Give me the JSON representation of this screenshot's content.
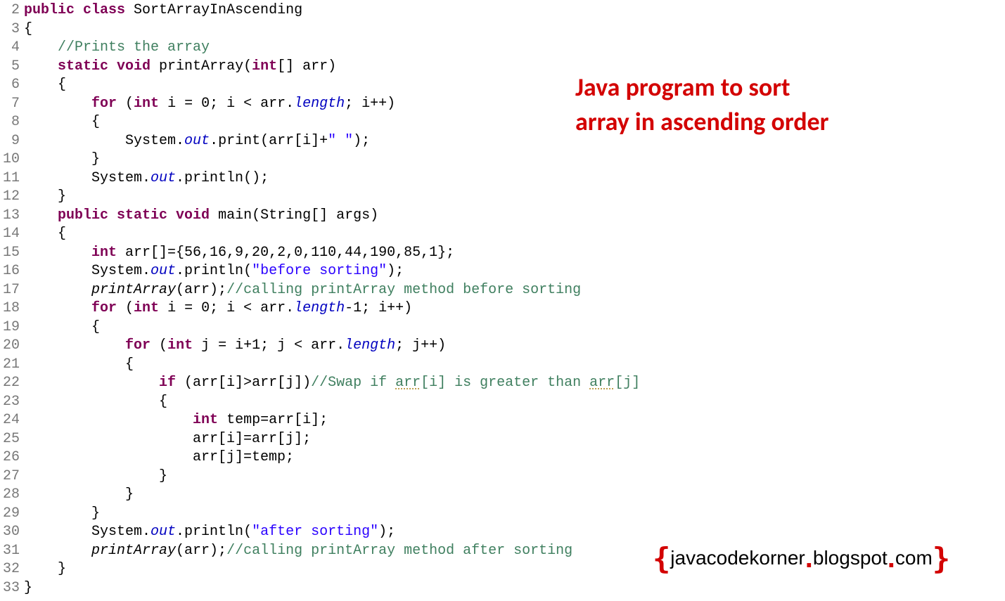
{
  "overlay": {
    "title_line1": "Java program to sort",
    "title_line2": "array in ascending order",
    "watermark_text": "javacodekorner",
    "watermark_domain": "blogspot",
    "watermark_tld": "com"
  },
  "gutter": {
    "start": 2,
    "end": 33
  },
  "code": {
    "lines": [
      {
        "n": 2,
        "segs": [
          {
            "t": "public class ",
            "c": "kw"
          },
          {
            "t": "SortArrayInAscending"
          }
        ]
      },
      {
        "n": 3,
        "segs": [
          {
            "t": "{"
          }
        ]
      },
      {
        "n": 4,
        "segs": [
          {
            "t": "    "
          },
          {
            "t": "//Prints the array",
            "c": "comment"
          }
        ]
      },
      {
        "n": 5,
        "segs": [
          {
            "t": "    "
          },
          {
            "t": "static void ",
            "c": "kw"
          },
          {
            "t": "printArray("
          },
          {
            "t": "int",
            "c": "kw"
          },
          {
            "t": "[] arr)"
          }
        ]
      },
      {
        "n": 6,
        "segs": [
          {
            "t": "    {"
          }
        ]
      },
      {
        "n": 7,
        "segs": [
          {
            "t": "        "
          },
          {
            "t": "for ",
            "c": "kw"
          },
          {
            "t": "("
          },
          {
            "t": "int ",
            "c": "kw"
          },
          {
            "t": "i = 0; i < arr."
          },
          {
            "t": "length",
            "c": "field"
          },
          {
            "t": "; i++)"
          }
        ]
      },
      {
        "n": 8,
        "segs": [
          {
            "t": "        {"
          }
        ]
      },
      {
        "n": 9,
        "segs": [
          {
            "t": "            System."
          },
          {
            "t": "out",
            "c": "field"
          },
          {
            "t": ".print(arr[i]+"
          },
          {
            "t": "\" \"",
            "c": "str"
          },
          {
            "t": ");"
          }
        ]
      },
      {
        "n": 10,
        "segs": [
          {
            "t": "        }"
          }
        ]
      },
      {
        "n": 11,
        "segs": [
          {
            "t": "        System."
          },
          {
            "t": "out",
            "c": "field"
          },
          {
            "t": ".println();"
          }
        ]
      },
      {
        "n": 12,
        "segs": [
          {
            "t": "    }"
          }
        ]
      },
      {
        "n": 13,
        "segs": [
          {
            "t": "    "
          },
          {
            "t": "public static void ",
            "c": "kw"
          },
          {
            "t": "main(String[] args)"
          }
        ]
      },
      {
        "n": 14,
        "segs": [
          {
            "t": "    {"
          }
        ]
      },
      {
        "n": 15,
        "segs": [
          {
            "t": "        "
          },
          {
            "t": "int ",
            "c": "kw"
          },
          {
            "t": "arr[]={56,16,9,20,2,0,110,44,190,85,1};"
          }
        ]
      },
      {
        "n": 16,
        "segs": [
          {
            "t": "        System."
          },
          {
            "t": "out",
            "c": "field"
          },
          {
            "t": ".println("
          },
          {
            "t": "\"before sorting\"",
            "c": "str"
          },
          {
            "t": ");"
          }
        ]
      },
      {
        "n": 17,
        "segs": [
          {
            "t": "        "
          },
          {
            "t": "printArray",
            "c": "call-italic"
          },
          {
            "t": "(arr);"
          },
          {
            "t": "//calling printArray method before sorting",
            "c": "comment"
          }
        ]
      },
      {
        "n": 18,
        "segs": [
          {
            "t": "        "
          },
          {
            "t": "for ",
            "c": "kw"
          },
          {
            "t": "("
          },
          {
            "t": "int ",
            "c": "kw"
          },
          {
            "t": "i = 0; i < arr."
          },
          {
            "t": "length",
            "c": "field"
          },
          {
            "t": "-1; i++)"
          }
        ]
      },
      {
        "n": 19,
        "segs": [
          {
            "t": "        {"
          }
        ]
      },
      {
        "n": 20,
        "segs": [
          {
            "t": "            "
          },
          {
            "t": "for ",
            "c": "kw"
          },
          {
            "t": "("
          },
          {
            "t": "int ",
            "c": "kw"
          },
          {
            "t": "j = i+1; j < arr."
          },
          {
            "t": "length",
            "c": "field"
          },
          {
            "t": "; j++)"
          }
        ]
      },
      {
        "n": 21,
        "segs": [
          {
            "t": "            {"
          }
        ]
      },
      {
        "n": 22,
        "segs": [
          {
            "t": "                "
          },
          {
            "t": "if ",
            "c": "kw"
          },
          {
            "t": "(arr[i]>arr[j])"
          },
          {
            "t": "//Swap if ",
            "c": "comment"
          },
          {
            "t": "arr",
            "c": "comment underline-dot"
          },
          {
            "t": "[i] is greater than ",
            "c": "comment"
          },
          {
            "t": "arr",
            "c": "comment underline-dot2"
          },
          {
            "t": "[j]",
            "c": "comment"
          }
        ]
      },
      {
        "n": 23,
        "segs": [
          {
            "t": "                {"
          }
        ]
      },
      {
        "n": 24,
        "segs": [
          {
            "t": "                    "
          },
          {
            "t": "int ",
            "c": "kw"
          },
          {
            "t": "temp=arr[i];"
          }
        ]
      },
      {
        "n": 25,
        "segs": [
          {
            "t": "                    arr[i]=arr[j];"
          }
        ]
      },
      {
        "n": 26,
        "segs": [
          {
            "t": "                    arr[j]=temp;"
          }
        ]
      },
      {
        "n": 27,
        "segs": [
          {
            "t": "                }"
          }
        ]
      },
      {
        "n": 28,
        "segs": [
          {
            "t": "            }"
          }
        ]
      },
      {
        "n": 29,
        "segs": [
          {
            "t": "        }"
          }
        ]
      },
      {
        "n": 30,
        "segs": [
          {
            "t": "        System."
          },
          {
            "t": "out",
            "c": "field"
          },
          {
            "t": ".println("
          },
          {
            "t": "\"after sorting\"",
            "c": "str"
          },
          {
            "t": ");"
          }
        ]
      },
      {
        "n": 31,
        "segs": [
          {
            "t": "        "
          },
          {
            "t": "printArray",
            "c": "call-italic"
          },
          {
            "t": "(arr);"
          },
          {
            "t": "//calling printArray method after sorting",
            "c": "comment"
          }
        ]
      },
      {
        "n": 32,
        "segs": [
          {
            "t": "    }"
          }
        ]
      },
      {
        "n": 33,
        "segs": [
          {
            "t": "}"
          }
        ]
      }
    ]
  }
}
